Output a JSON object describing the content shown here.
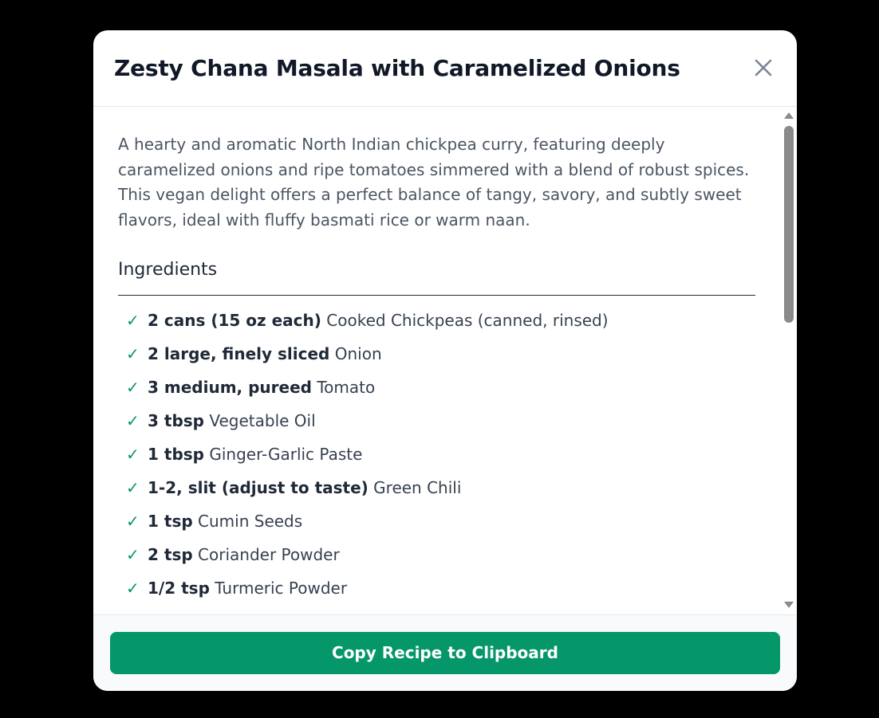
{
  "modal": {
    "title": "Zesty Chana Masala with Caramelized Onions",
    "close_icon": "close-icon"
  },
  "description": "A hearty and aromatic North Indian chickpea curry, featuring deeply caramelized onions and ripe tomatoes simmered with a blend of robust spices. This vegan delight offers a perfect balance of tangy, savory, and subtly sweet flavors, ideal with fluffy basmati rice or warm naan.",
  "ingredients_section": {
    "title": "Ingredients",
    "check_glyph": "✓",
    "items": [
      {
        "qty": "2 cans (15 oz each)",
        "name": "Cooked Chickpeas (canned, rinsed)"
      },
      {
        "qty": "2 large, finely sliced",
        "name": "Onion"
      },
      {
        "qty": "3 medium, pureed",
        "name": "Tomato"
      },
      {
        "qty": "3 tbsp",
        "name": "Vegetable Oil"
      },
      {
        "qty": "1 tbsp",
        "name": "Ginger-Garlic Paste"
      },
      {
        "qty": "1-2, slit (adjust to taste)",
        "name": "Green Chili"
      },
      {
        "qty": "1 tsp",
        "name": "Cumin Seeds"
      },
      {
        "qty": "2 tsp",
        "name": "Coriander Powder"
      },
      {
        "qty": "1/2 tsp",
        "name": "Turmeric Powder"
      }
    ]
  },
  "footer": {
    "copy_button_label": "Copy Recipe to Clipboard"
  },
  "colors": {
    "accent": "#059669",
    "title": "#111827",
    "body_text": "#4b5563",
    "backdrop": "#000000"
  }
}
